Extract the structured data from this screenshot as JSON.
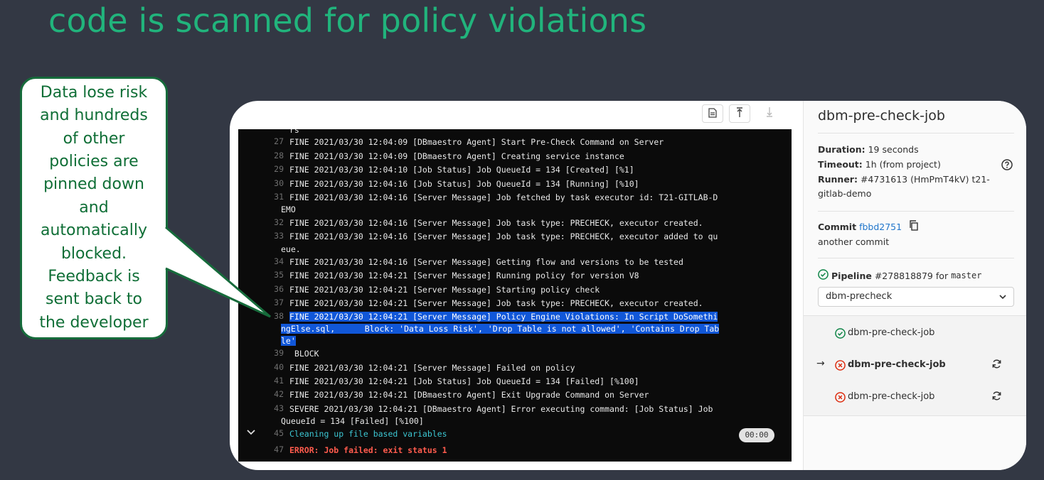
{
  "slide": {
    "title": "code is scanned for policy violations",
    "callout": "Data lose risk\nand hundreds\nof other\npolicies are\npinned down\nand\nautomatically\nblocked.\nFeedback is\nsent back to\nthe developer"
  },
  "log": {
    "partial_top": "rs",
    "lines": [
      {
        "n": "27",
        "text": "FINE 2021/03/30 12:04:09 [DBmaestro Agent] Start Pre-Check Command on Server"
      },
      {
        "n": "28",
        "text": "FINE 2021/03/30 12:04:09 [DBmaestro Agent] Creating service instance"
      },
      {
        "n": "29",
        "text": "FINE 2021/03/30 12:04:10 [Job Status] Job QueueId = 134 [Created] [%1]"
      },
      {
        "n": "30",
        "text": "FINE 2021/03/30 12:04:16 [Job Status] Job QueueId = 134 [Running] [%10]"
      },
      {
        "n": "31",
        "text": "FINE 2021/03/30 12:04:16 [Server Message] Job fetched by task executor id: T21-GITLAB-D",
        "cont": "EMO"
      },
      {
        "n": "32",
        "text": "FINE 2021/03/30 12:04:16 [Server Message] Job task type: PRECHECK, executor created."
      },
      {
        "n": "33",
        "text": "FINE 2021/03/30 12:04:16 [Server Message] Job task type: PRECHECK, executor added to qu",
        "cont": "eue."
      },
      {
        "n": "34",
        "text": "FINE 2021/03/30 12:04:16 [Server Message] Getting flow and versions to be tested"
      },
      {
        "n": "35",
        "text": "FINE 2021/03/30 12:04:21 [Server Message] Running policy for version V8"
      },
      {
        "n": "36",
        "text": "FINE 2021/03/30 12:04:21 [Server Message] Starting policy check"
      },
      {
        "n": "37",
        "text": "FINE 2021/03/30 12:04:21 [Server Message] Job task type: PRECHECK, executor created."
      },
      {
        "n": "38",
        "text": "FINE 2021/03/30 12:04:21 [Server Message] Policy Engine Violations: In Script DoSomethi",
        "cont": "ngElse.sql,      Block: 'Data Loss Risk', 'Drop Table is not allowed', 'Contains Drop Tab",
        "cont2": "le'",
        "highlight": true
      },
      {
        "n": "39",
        "text": " BLOCK"
      },
      {
        "n": "40",
        "text": "FINE 2021/03/30 12:04:21 [Server Message] Failed on policy"
      },
      {
        "n": "41",
        "text": "FINE 2021/03/30 12:04:21 [Job Status] Job QueueId = 134 [Failed] [%100]"
      },
      {
        "n": "42",
        "text": "FINE 2021/03/30 12:04:21 [DBmaestro Agent] Exit Upgrade Command on Server"
      },
      {
        "n": "43",
        "text": "SEVERE 2021/03/30 12:04:21 [DBmaestro Agent] Error executing command: [Job Status] Job",
        "cont": "QueueId = 134 [Failed] [%100]"
      },
      {
        "n": "45",
        "text": "Cleaning up file based variables",
        "style": "cyan",
        "collapsible": true,
        "duration": "00:00"
      },
      {
        "n": "47",
        "text": "ERROR: Job failed: exit status 1",
        "style": "red"
      }
    ]
  },
  "sidebar": {
    "title": "dbm-pre-check-job",
    "duration_label": "Duration:",
    "duration_value": "19 seconds",
    "timeout_label": "Timeout:",
    "timeout_value": "1h (from project)",
    "runner_label": "Runner:",
    "runner_value": "#4731613 (HmPmT4kV) t21-gitlab-demo",
    "commit_label": "Commit",
    "commit_sha": "fbbd2751",
    "commit_message": "another commit",
    "pipeline_label": "Pipeline",
    "pipeline_id": "#278818879",
    "pipeline_for": "for",
    "pipeline_branch": "master",
    "stage": "dbm-precheck",
    "jobs": [
      {
        "name": "dbm-pre-check-job",
        "status": "passed",
        "current": false,
        "retry": false
      },
      {
        "name": "dbm-pre-check-job",
        "status": "failed",
        "current": true,
        "retry": true
      },
      {
        "name": "dbm-pre-check-job",
        "status": "failed",
        "current": false,
        "retry": true
      }
    ],
    "colors": {
      "passed": "#108548",
      "failed": "#dd2b0e",
      "link": "#1f75cb"
    }
  }
}
